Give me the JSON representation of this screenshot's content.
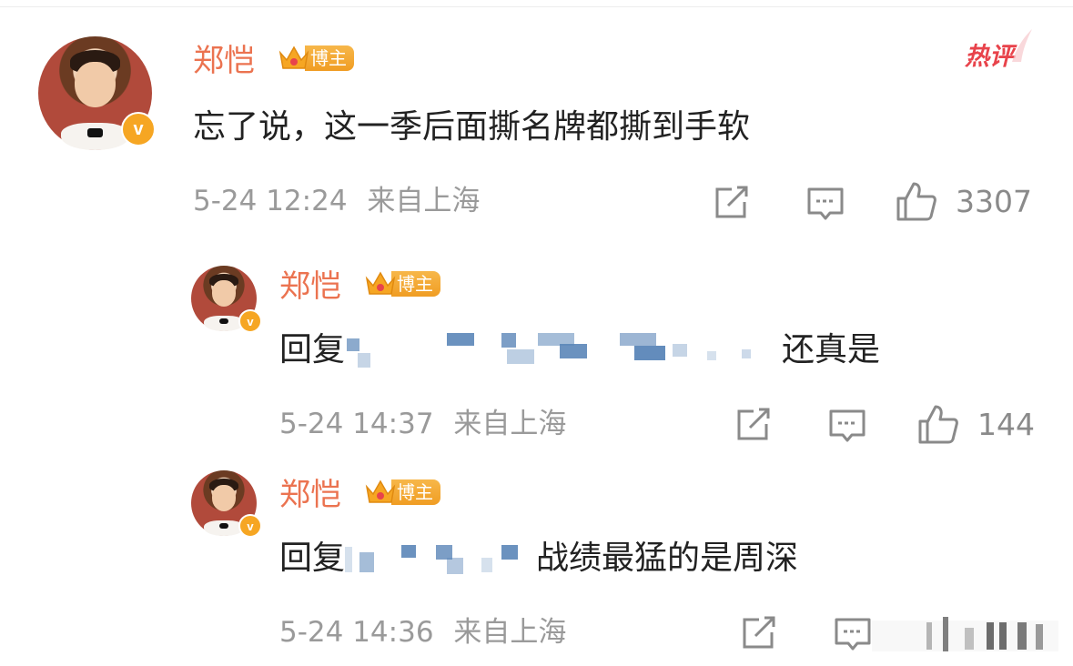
{
  "comments": [
    {
      "name": "郑恺",
      "badge": "博主",
      "text": "忘了说，这一季后面撕名牌都撕到手软",
      "date": "5-24 12:24",
      "location": "来自上海",
      "likes": "3307"
    },
    {
      "name": "郑恺",
      "badge": "博主",
      "prefix": "回复",
      "text": "还真是",
      "date": "5-24 14:37",
      "location": "来自上海",
      "likes": "144"
    },
    {
      "name": "郑恺",
      "badge": "博主",
      "prefix": "回复",
      "text": "战绩最猛的是周深",
      "date": "5-24 14:36",
      "location": "来自上海",
      "likes": ""
    }
  ],
  "hot_label": "热评",
  "colors": {
    "name": "#eb7350",
    "hot": "#e8434b",
    "badge": "#f6a623",
    "meta": "#9a9a9a"
  },
  "icons": [
    "share-icon",
    "comment-icon",
    "like-icon",
    "verified-v-icon",
    "crown-icon"
  ]
}
